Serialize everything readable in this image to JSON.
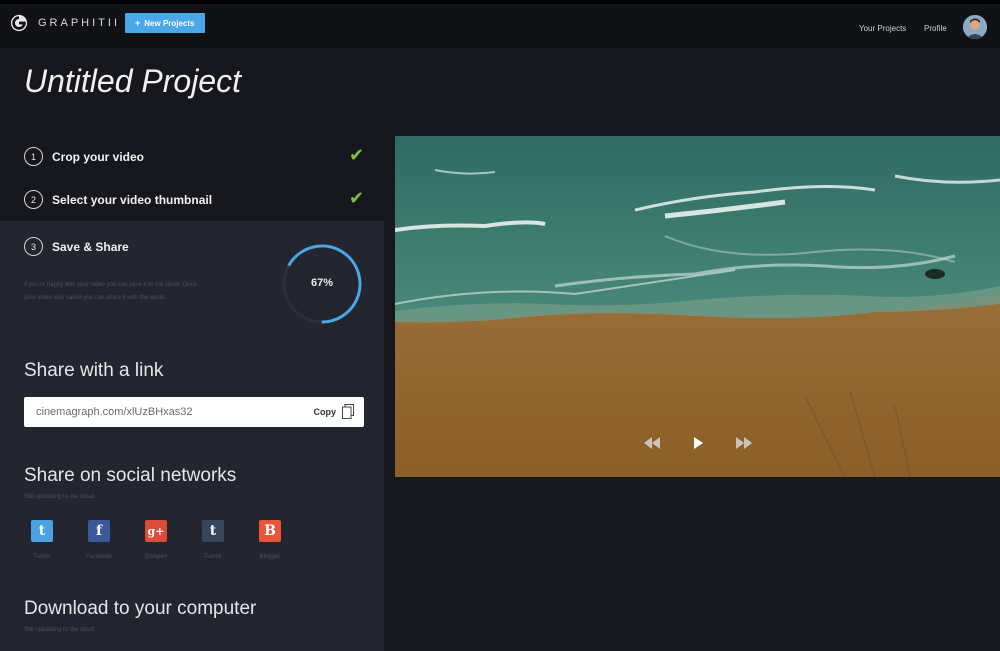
{
  "header": {
    "brand": "GRAPHITII",
    "new_project_label": "New Projects",
    "nav": {
      "projects": "Your Projects",
      "profile": "Profile"
    }
  },
  "page": {
    "title": "Untitled Project"
  },
  "steps": [
    {
      "number": "1",
      "label": "Crop your video",
      "done": true
    },
    {
      "number": "2",
      "label": "Select your video thumbnail",
      "done": true
    },
    {
      "number": "3",
      "label": "Save & Share",
      "done": false
    }
  ],
  "save": {
    "description": "If you're happy with your video you can save it to the cloud. Once your video was saved you can share it with the world.",
    "progress_value": 0.67,
    "progress_text": "67%"
  },
  "share_link": {
    "title": "Share with a link",
    "url": "cinemagraph.com/xlUzBHxas32",
    "copy_label": "Copy"
  },
  "social": {
    "title": "Share on social networks",
    "subtitle": "Still uploading to the cloud",
    "networks": [
      {
        "label": "Twitter",
        "glyph": "t",
        "color": "#4aa2e3"
      },
      {
        "label": "Facebook",
        "glyph": "f",
        "color": "#3b5998"
      },
      {
        "label": "Google+",
        "glyph": "g+",
        "color": "#dd4b39"
      },
      {
        "label": "Tumblr",
        "glyph": "t",
        "color": "#36465d"
      },
      {
        "label": "Blogger",
        "glyph": "B",
        "color": "#e8563a"
      }
    ]
  },
  "download": {
    "title": "Download to your computer",
    "subtitle": "Still uploading to the cloud"
  },
  "icons": {
    "logo": "logo-icon",
    "check": "check-icon",
    "copy": "copy-icon",
    "rewind": "rewind-icon",
    "play": "play-icon",
    "forward": "fast-forward-icon"
  },
  "colors": {
    "accent": "#4aa7e8",
    "check": "#7fbf3b",
    "progress": "#4aa7e8"
  }
}
